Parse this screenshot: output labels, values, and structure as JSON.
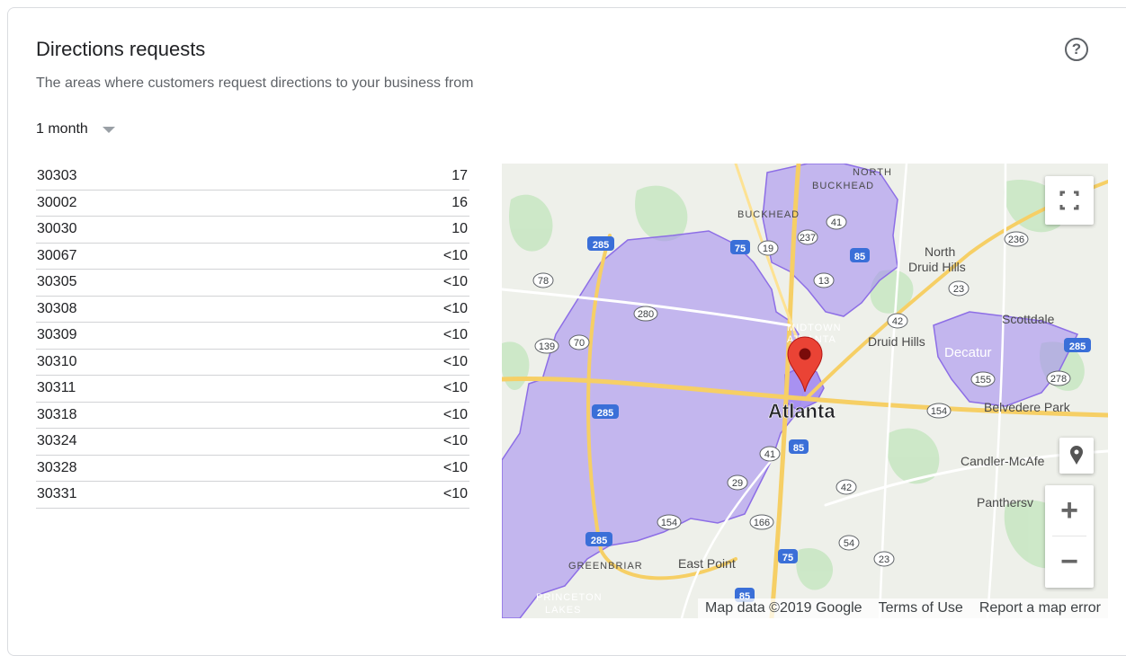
{
  "header": {
    "title": "Directions requests",
    "subtitle": "The areas where customers request directions to your business from",
    "help_icon": "help-circle-icon"
  },
  "period": {
    "selected": "1 month"
  },
  "table": {
    "rows": [
      {
        "zip": "30303",
        "count": "17"
      },
      {
        "zip": "30002",
        "count": "16"
      },
      {
        "zip": "30030",
        "count": "10"
      },
      {
        "zip": "30067",
        "count": "<10"
      },
      {
        "zip": "30305",
        "count": "<10"
      },
      {
        "zip": "30308",
        "count": "<10"
      },
      {
        "zip": "30309",
        "count": "<10"
      },
      {
        "zip": "30310",
        "count": "<10"
      },
      {
        "zip": "30311",
        "count": "<10"
      },
      {
        "zip": "30318",
        "count": "<10"
      },
      {
        "zip": "30324",
        "count": "<10"
      },
      {
        "zip": "30328",
        "count": "<10"
      },
      {
        "zip": "30331",
        "count": "<10"
      }
    ]
  },
  "map": {
    "region_color": "#a68ff0",
    "pin_color": "#ea4335",
    "labels": {
      "atlanta": "Atlanta",
      "north_buckhead": "NORTH BUCKHEAD",
      "buckhead": "BUCKHEAD",
      "north_druid_hills": "North Druid Hills",
      "druid_hills": "Druid Hills",
      "midtown": "MIDTOWN ATLANTA",
      "scottdale": "Scottdale",
      "decatur": "Decatur",
      "belvedere_park": "Belvedere Park",
      "candler_mcafee": "Candler-McAfe",
      "panthersville": "Panthersv",
      "east_point": "East Point",
      "greenbriar": "GREENBRIAR",
      "princeton_lakes": "PRINCETON LAKES"
    },
    "road_shields": [
      "285",
      "75",
      "41",
      "19",
      "237",
      "85",
      "13",
      "236",
      "23",
      "78",
      "280",
      "42",
      "139",
      "70",
      "155",
      "278",
      "154",
      "29",
      "166",
      "54"
    ],
    "attribution": {
      "map_data": "Map data ©2019 Google",
      "terms": "Terms of Use",
      "report": "Report a map error"
    },
    "controls": {
      "fullscreen_icon": "fullscreen-icon",
      "pegman_icon": "street-view-pin-icon",
      "zoom_in": "+",
      "zoom_out": "−"
    }
  }
}
